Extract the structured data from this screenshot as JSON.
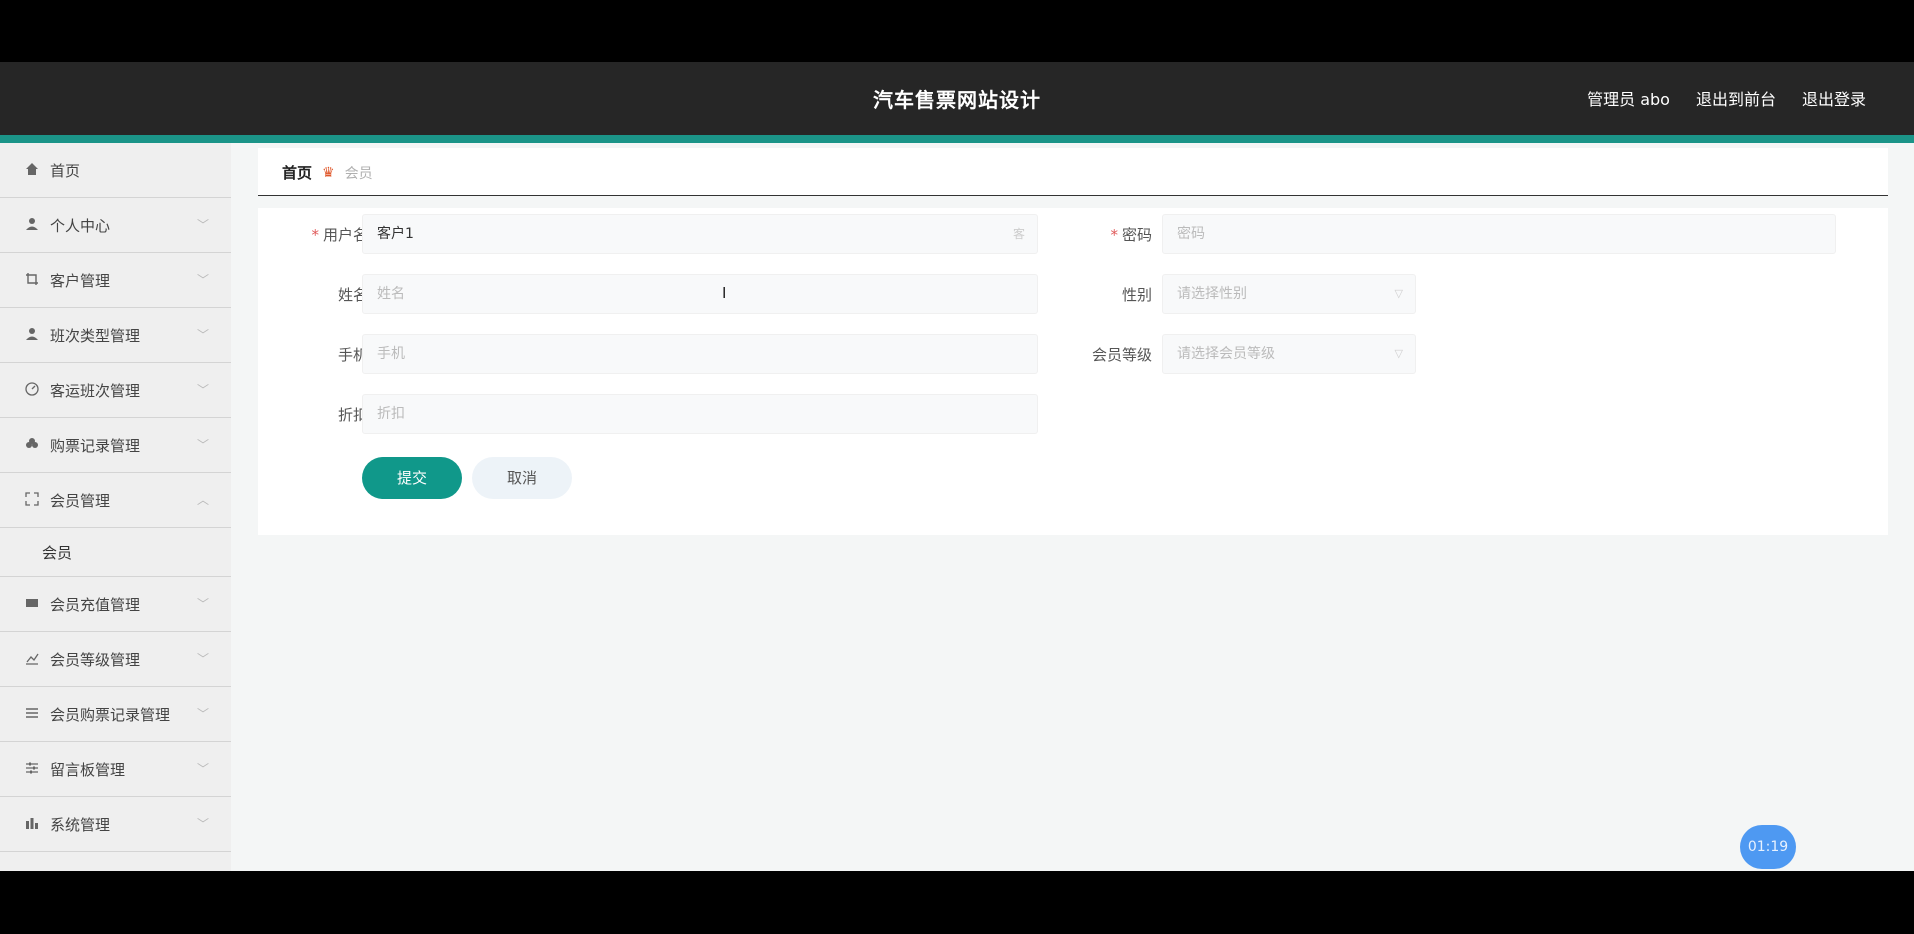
{
  "header": {
    "title": "汽车售票网站设计",
    "user_label": "管理员 abo",
    "front_link": "退出到前台",
    "logout_link": "退出登录"
  },
  "sidebar": {
    "items": [
      {
        "label": "首页",
        "icon": "home-icon"
      },
      {
        "label": "个人中心",
        "icon": "user-icon"
      },
      {
        "label": "客户管理",
        "icon": "crop-icon"
      },
      {
        "label": "班次类型管理",
        "icon": "user-icon"
      },
      {
        "label": "客运班次管理",
        "icon": "gauge-icon"
      },
      {
        "label": "购票记录管理",
        "icon": "flower-icon"
      },
      {
        "label": "会员管理",
        "icon": "expand-icon"
      },
      {
        "label": "会员充值管理",
        "icon": "ticket-icon"
      },
      {
        "label": "会员等级管理",
        "icon": "chart-icon"
      },
      {
        "label": "会员购票记录管理",
        "icon": "list-icon"
      },
      {
        "label": "留言板管理",
        "icon": "sliders-icon"
      },
      {
        "label": "系统管理",
        "icon": "bar-chart-icon"
      }
    ],
    "submenu": {
      "label": "会员"
    }
  },
  "breadcrumb": {
    "home": "首页",
    "current": "会员"
  },
  "form": {
    "username": {
      "label": "用户名",
      "value": "客户1",
      "suffix": "客"
    },
    "password": {
      "label": "密码",
      "placeholder": "密码"
    },
    "name": {
      "label": "姓名",
      "placeholder": "姓名"
    },
    "gender": {
      "label": "性别",
      "placeholder": "请选择性别"
    },
    "phone": {
      "label": "手机",
      "placeholder": "手机"
    },
    "level": {
      "label": "会员等级",
      "placeholder": "请选择会员等级"
    },
    "discount": {
      "label": "折扣",
      "placeholder": "折扣"
    },
    "submit_label": "提交",
    "cancel_label": "取消"
  },
  "timer": "01:19"
}
